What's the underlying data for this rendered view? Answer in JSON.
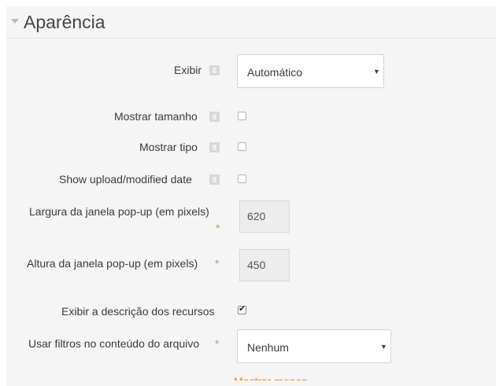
{
  "section": {
    "title": "Aparência"
  },
  "fields": {
    "display": {
      "label": "Exibir",
      "value": "Automático"
    },
    "show_size": {
      "label": "Mostrar tamanho",
      "checked": false
    },
    "show_type": {
      "label": "Mostrar tipo",
      "checked": false
    },
    "show_date": {
      "label": "Show upload/modified date",
      "checked": false
    },
    "popup_width": {
      "label": "Largura da janela pop-up (em pixels)",
      "required_mark": "*",
      "value": "620"
    },
    "popup_height": {
      "label": "Altura da janela pop-up (em pixels)",
      "required_mark": "*",
      "value": "450"
    },
    "print_intro": {
      "label": "Exibir a descrição dos recursos",
      "checked": true
    },
    "filter_files": {
      "label": "Usar filtros no conteúdo do arquivo",
      "required_mark": "*",
      "value": "Nenhum"
    }
  },
  "links": {
    "show_less": "Mostrar menos..."
  },
  "colors": {
    "required": "#7bc042",
    "link": "#f98012",
    "panel_bg": "#f5f5f5"
  },
  "icons": {
    "help": "help-icon",
    "collapse": "caret-down-icon",
    "dropdown": "chevron-down-icon"
  }
}
